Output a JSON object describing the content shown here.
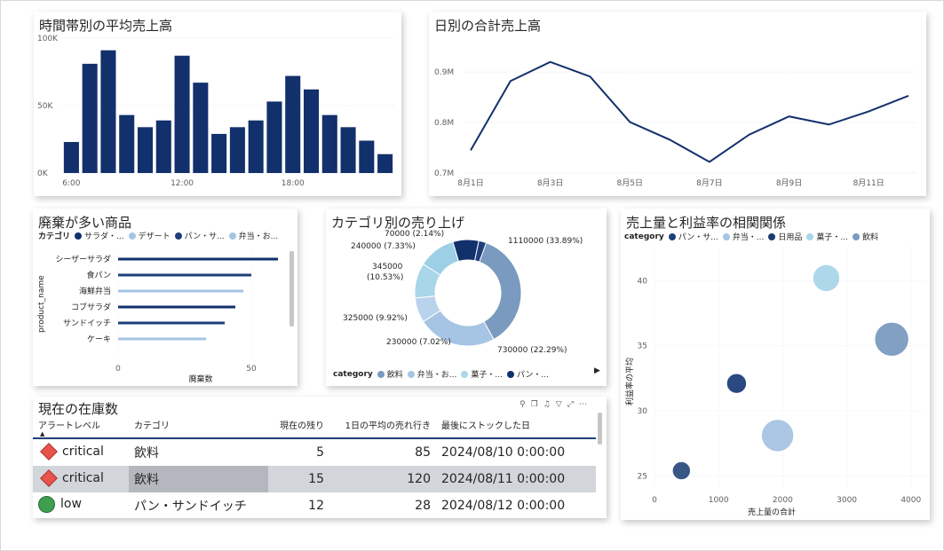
{
  "chart_data": [
    {
      "type": "bar",
      "title": "時間帯別の平均売上高",
      "x_tick_labels": [
        "6:00",
        "12:00",
        "18:00"
      ],
      "y_tick_labels": [
        "0K",
        "50K",
        "100K"
      ],
      "ylim": [
        0,
        100000
      ],
      "values": [
        23000,
        81000,
        91000,
        43000,
        34000,
        39000,
        87000,
        67000,
        29000,
        34000,
        39000,
        53000,
        72000,
        62000,
        43000,
        34000,
        24000,
        14000
      ]
    },
    {
      "type": "line",
      "title": "日別の合計売上高",
      "x": [
        "8月1日",
        "8月2日",
        "8月3日",
        "8月4日",
        "8月5日",
        "8月6日",
        "8月7日",
        "8月8日",
        "8月9日",
        "8月10日",
        "8月11日",
        "8月12日"
      ],
      "x_tick_labels": [
        "8月1日",
        "8月3日",
        "8月5日",
        "8月7日",
        "8月9日",
        "8月11日"
      ],
      "y_tick_labels": [
        "0.7M",
        "0.8M",
        "0.9M"
      ],
      "ylim": [
        0.7,
        0.96
      ],
      "values": [
        0.745,
        0.882,
        0.92,
        0.891,
        0.801,
        0.766,
        0.722,
        0.776,
        0.812,
        0.796,
        0.822,
        0.853
      ]
    },
    {
      "type": "bar",
      "orientation": "horizontal",
      "title": "廃棄が多い商品",
      "legend_title": "カテゴリ",
      "legend": [
        {
          "name": "サラダ・...",
          "color": "#12306b"
        },
        {
          "name": "デザート",
          "color": "#a6c4e3"
        },
        {
          "name": "パン・サ...",
          "color": "#1f3f7a"
        },
        {
          "name": "弁当・お...",
          "color": "#a6c4e3"
        }
      ],
      "ylabel": "product_name",
      "xlabel": "廃棄数",
      "x_tick_labels": [
        "0",
        "50"
      ],
      "xlim": [
        0,
        62
      ],
      "categories": [
        "シーザーサラダ",
        "食パン",
        "海鮮弁当",
        "コブサラダ",
        "サンドイッチ",
        "ケーキ"
      ],
      "values": [
        60,
        50,
        47,
        44,
        40,
        33
      ],
      "colors": [
        "#12306b",
        "#1f3f7a",
        "#a6c4e3",
        "#12306b",
        "#1f3f7a",
        "#a6c4e3"
      ]
    },
    {
      "type": "pie",
      "title": "カテゴリ別の売り上げ",
      "legend_title": "category",
      "legend": [
        {
          "name": "飲料",
          "color": "#7a9bbf"
        },
        {
          "name": "弁当・お...",
          "color": "#a6c4e3"
        },
        {
          "name": "菓子・...",
          "color": "#a9d6e8"
        },
        {
          "name": "パン・...",
          "color": "#12306b"
        }
      ],
      "slices": [
        {
          "value": 1110000,
          "label": "1110000 (33.89%)",
          "color": "#7a9bbf"
        },
        {
          "value": 730000,
          "label": "730000 (22.29%)",
          "color": "#a6c4e3"
        },
        {
          "value": 230000,
          "label": "230000 (7.02%)",
          "color": "#b9d3ec"
        },
        {
          "value": 325000,
          "label": "325000 (9.92%)",
          "color": "#a9d6e8"
        },
        {
          "value": 345000,
          "label_line1": "345000",
          "label_line2": "(10.53%)",
          "color": "#9dcfe6"
        },
        {
          "value": 240000,
          "label": "240000 (7.33%)",
          "color": "#12306b"
        },
        {
          "value": 70000,
          "label": "70000 (2.14%)",
          "color": "#1f3f7a"
        }
      ]
    },
    {
      "type": "scatter",
      "title": "売上量と利益率の相関関係",
      "legend_title": "category",
      "legend": [
        {
          "name": "パン・サ...",
          "color": "#1f3f7a"
        },
        {
          "name": "弁当・...",
          "color": "#a6c4e3"
        },
        {
          "name": "日用品",
          "color": "#1b3a6e"
        },
        {
          "name": "菓子・...",
          "color": "#a9d6e8"
        },
        {
          "name": "飲料",
          "color": "#7a9bbf"
        }
      ],
      "xlabel": "売上量の合計",
      "ylabel": "利益率の平均",
      "x_tick_labels": [
        "0",
        "1000",
        "2000",
        "3000",
        "4000"
      ],
      "y_tick_labels": [
        "25",
        "30",
        "35",
        "40"
      ],
      "xlim": [
        0,
        4100
      ],
      "ylim": [
        24,
        42
      ],
      "points": [
        {
          "x": 420,
          "y": 25.4,
          "r": 10,
          "color": "#2d4e7e"
        },
        {
          "x": 1280,
          "y": 32.1,
          "r": 11,
          "color": "#1f3f7a"
        },
        {
          "x": 1920,
          "y": 28.1,
          "r": 18,
          "color": "#a6c4e3"
        },
        {
          "x": 2680,
          "y": 40.2,
          "r": 15,
          "color": "#a9d6e8"
        },
        {
          "x": 3700,
          "y": 35.5,
          "r": 19,
          "color": "#7a9bbf"
        }
      ]
    }
  ],
  "inventory": {
    "title": "現在の在庫数",
    "columns": [
      "アラートレベル",
      "カテゴリ",
      "現在の残り",
      "1日の平均の売れ行き",
      "最後にストックした日"
    ],
    "rows": [
      {
        "alert": "critical",
        "category": "飲料",
        "remaining": "5",
        "avg": "85",
        "date": "2024/08/10 0:00:00"
      },
      {
        "alert": "critical",
        "category": "飲料",
        "remaining": "15",
        "avg": "120",
        "date": "2024/08/11 0:00:00"
      },
      {
        "alert": "low",
        "category": "パン・サンドイッチ",
        "remaining": "12",
        "avg": "28",
        "date": "2024/08/12 0:00:00"
      }
    ]
  }
}
